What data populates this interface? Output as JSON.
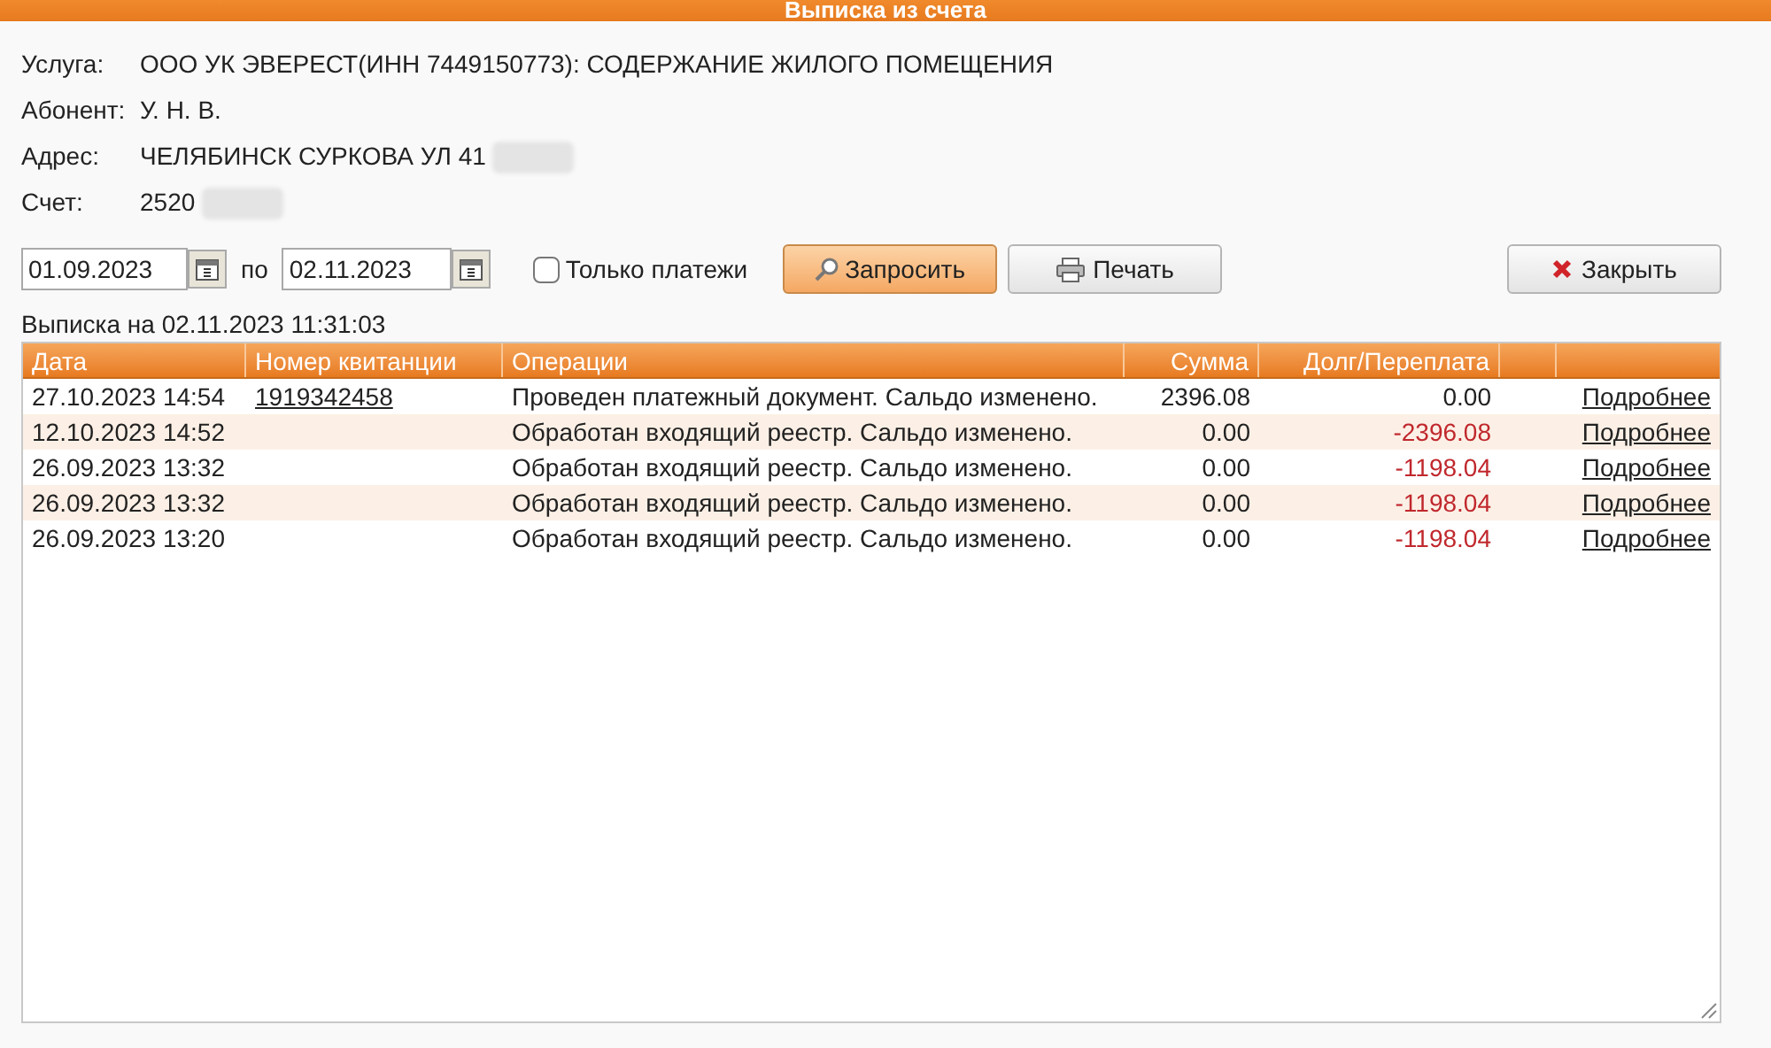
{
  "window": {
    "title": "Выписка из счета"
  },
  "info": [
    {
      "label": "Услуга:",
      "value": "ООО УК ЭВЕРЕСТ(ИНН 7449150773): СОДЕРЖАНИЕ ЖИЛОГО ПОМЕЩЕНИЯ",
      "redacted": false
    },
    {
      "label": "Абонент:",
      "value": "У. Н. В.",
      "redacted": false
    },
    {
      "label": "Адрес:",
      "value": "ЧЕЛЯБИНСК СУРКОВА УЛ 41",
      "redacted": true
    },
    {
      "label": "Счет:",
      "value": "2520",
      "redacted": true
    }
  ],
  "filter": {
    "date_from": "01.09.2023",
    "separator": "по",
    "date_to": "02.11.2023",
    "only_payments": {
      "label": "Только платежи",
      "checked": false
    },
    "query_button": "Запросить",
    "print_button": "Печать",
    "close_button": "Закрыть"
  },
  "statement_caption": "Выписка на 02.11.2023 11:31:03",
  "table": {
    "columns": [
      "Дата",
      "Номер квитанции",
      "Операции",
      "Сумма",
      "Долг/Переплата"
    ],
    "rows": [
      {
        "date": "27.10.2023 14:54",
        "receipt": "1919342458",
        "operation": "Проведен платежный документ. Сальдо изменено.",
        "amount": "2396.08",
        "balance": "0.00",
        "negative": false,
        "details": "Подробнее"
      },
      {
        "date": "12.10.2023 14:52",
        "operation": "Обработан входящий реестр. Сальдо изменено.",
        "amount": "0.00",
        "balance": "-2396.08",
        "negative": true,
        "details": "Подробнее"
      },
      {
        "date": "26.09.2023 13:32",
        "operation": "Обработан входящий реестр. Сальдо изменено.",
        "amount": "0.00",
        "balance": "-1198.04",
        "negative": true,
        "details": "Подробнее"
      },
      {
        "date": "26.09.2023 13:32",
        "operation": "Обработан входящий реестр. Сальдо изменено.",
        "amount": "0.00",
        "balance": "-1198.04",
        "negative": true,
        "details": "Подробнее"
      },
      {
        "date": "26.09.2023 13:20",
        "operation": "Обработан входящий реестр. Сальдо изменено.",
        "amount": "0.00",
        "balance": "-1198.04",
        "negative": true,
        "details": "Подробнее"
      }
    ]
  }
}
